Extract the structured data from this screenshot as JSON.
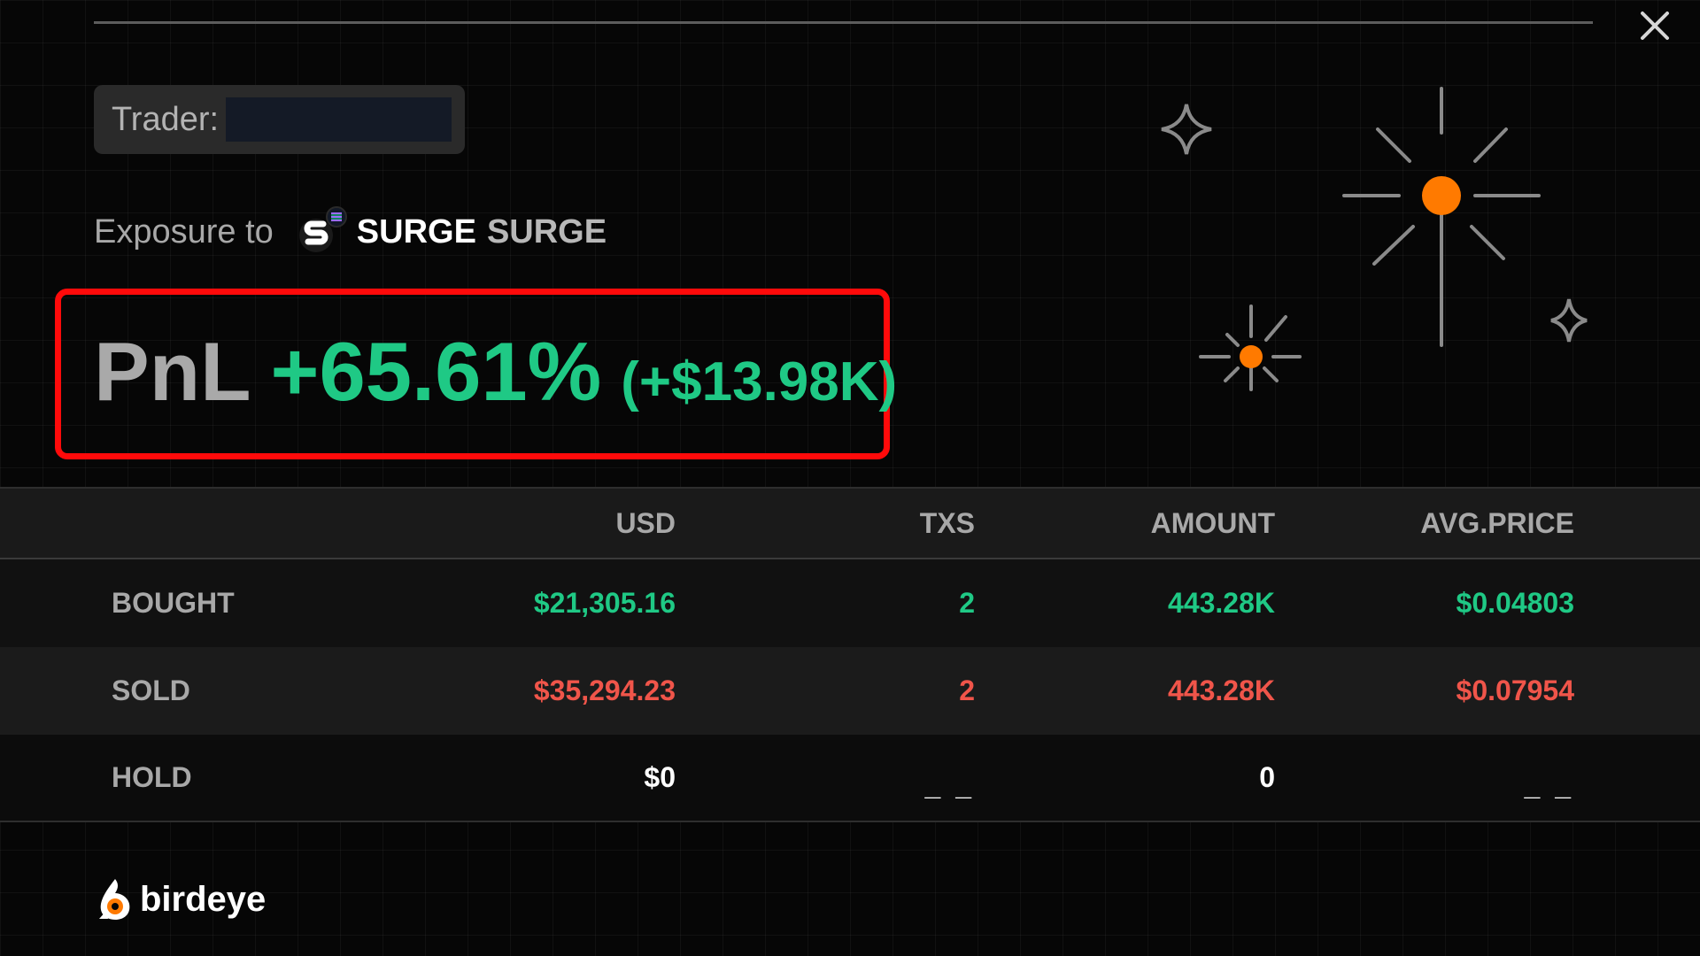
{
  "header": {
    "close_icon": "close-icon"
  },
  "trader": {
    "label": "Trader:"
  },
  "exposure": {
    "label": "Exposure to",
    "token_icon": "surge-token-logo",
    "token_symbol": "SURGE",
    "token_name": "SURGE"
  },
  "pnl": {
    "label": "PnL",
    "percent": "+65.61%",
    "absolute": "(+$13.98K)"
  },
  "table": {
    "columns": [
      "",
      "USD",
      "TXS",
      "AMOUNT",
      "AVG.PRICE"
    ],
    "rows": [
      {
        "label": "BOUGHT",
        "usd": "$21,305.16",
        "txs": "2",
        "amount": "443.28K",
        "avg_price": "$0.04803"
      },
      {
        "label": "SOLD",
        "usd": "$35,294.23",
        "txs": "2",
        "amount": "443.28K",
        "avg_price": "$0.07954"
      },
      {
        "label": "HOLD",
        "usd": "$0",
        "txs": "_ _",
        "amount": "0",
        "avg_price": "_ _"
      }
    ]
  },
  "brand": {
    "name": "birdeye",
    "logo_icon": "birdeye-logo"
  },
  "colors": {
    "positive": "#1fc985",
    "negative": "#f0554a",
    "accent": "#ff7a00",
    "highlight_frame": "#ff0a0a"
  }
}
